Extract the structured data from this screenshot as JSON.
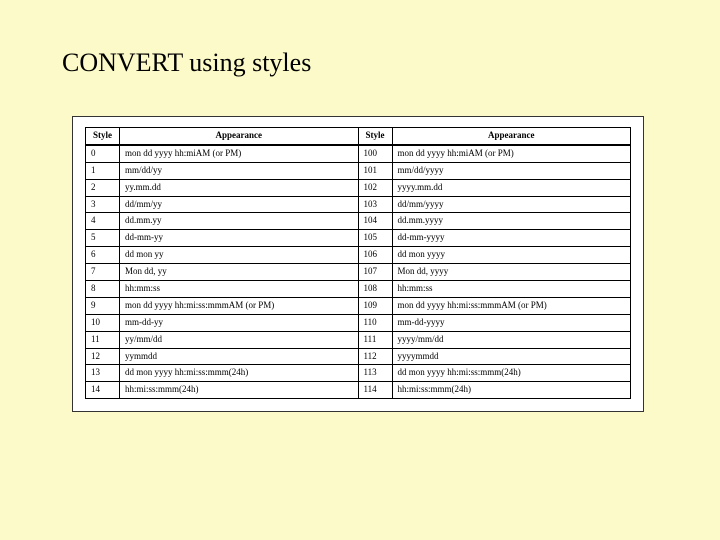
{
  "title": "CONVERT using styles",
  "headers": {
    "style_left": "Style",
    "appearance_left": "Appearance",
    "style_right": "Style",
    "appearance_right": "Appearance"
  },
  "rows": [
    {
      "l_style": "0",
      "l_app": "mon dd yyyy hh:miAM (or PM)",
      "r_style": "100",
      "r_app": "mon dd yyyy hh:miAM (or PM)"
    },
    {
      "l_style": "1",
      "l_app": "mm/dd/yy",
      "r_style": "101",
      "r_app": "mm/dd/yyyy"
    },
    {
      "l_style": "2",
      "l_app": "yy.mm.dd",
      "r_style": "102",
      "r_app": "yyyy.mm.dd"
    },
    {
      "l_style": "3",
      "l_app": "dd/mm/yy",
      "r_style": "103",
      "r_app": "dd/mm/yyyy"
    },
    {
      "l_style": "4",
      "l_app": "dd.mm.yy",
      "r_style": "104",
      "r_app": "dd.mm.yyyy"
    },
    {
      "l_style": "5",
      "l_app": "dd-mm-yy",
      "r_style": "105",
      "r_app": "dd-mm-yyyy"
    },
    {
      "l_style": "6",
      "l_app": "dd mon yy",
      "r_style": "106",
      "r_app": "dd mon yyyy"
    },
    {
      "l_style": "7",
      "l_app": "Mon dd, yy",
      "r_style": "107",
      "r_app": "Mon dd, yyyy"
    },
    {
      "l_style": "8",
      "l_app": "hh:mm:ss",
      "r_style": "108",
      "r_app": "hh:mm:ss"
    },
    {
      "l_style": "9",
      "l_app": "mon dd yyyy hh:mi:ss:mmmAM (or PM)",
      "r_style": "109",
      "r_app": "mon dd yyyy hh:mi:ss:mmmAM (or PM)"
    },
    {
      "l_style": "10",
      "l_app": "mm-dd-yy",
      "r_style": "110",
      "r_app": "mm-dd-yyyy"
    },
    {
      "l_style": "11",
      "l_app": "yy/mm/dd",
      "r_style": "111",
      "r_app": "yyyy/mm/dd"
    },
    {
      "l_style": "12",
      "l_app": "yymmdd",
      "r_style": "112",
      "r_app": "yyyymmdd"
    },
    {
      "l_style": "13",
      "l_app": "dd mon yyyy hh:mi:ss:mmm(24h)",
      "r_style": "113",
      "r_app": "dd mon yyyy hh:mi:ss:mmm(24h)"
    },
    {
      "l_style": "14",
      "l_app": "hh:mi:ss:mmm(24h)",
      "r_style": "114",
      "r_app": "hh:mi:ss:mmm(24h)"
    }
  ]
}
